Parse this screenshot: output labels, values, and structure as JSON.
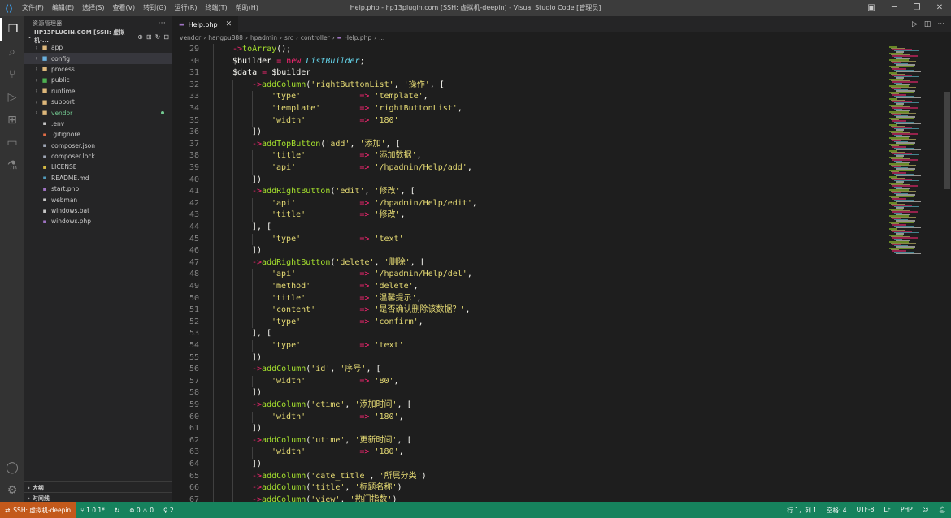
{
  "menubar": {
    "items": [
      "文件(F)",
      "编辑(E)",
      "选择(S)",
      "查看(V)",
      "转到(G)",
      "运行(R)",
      "终端(T)",
      "帮助(H)"
    ],
    "window_title": "Help.php - hp13plugin.com [SSH: 虚拟机-deepin] - Visual Studio Code [管理员]"
  },
  "sidebar": {
    "header": "资源管理器",
    "section_title": "HP13PLUGIN.COM [SSH: 虚拟机-...",
    "items": [
      {
        "label": "app",
        "type": "folder"
      },
      {
        "label": "config",
        "type": "folder"
      },
      {
        "label": "process",
        "type": "folder"
      },
      {
        "label": "public",
        "type": "folder"
      },
      {
        "label": "runtime",
        "type": "folder"
      },
      {
        "label": "support",
        "type": "folder"
      },
      {
        "label": "vendor",
        "type": "folder"
      },
      {
        "label": ".env",
        "type": "file"
      },
      {
        "label": ".gitignore",
        "type": "file"
      },
      {
        "label": "composer.json",
        "type": "file"
      },
      {
        "label": "composer.lock",
        "type": "file"
      },
      {
        "label": "LICENSE",
        "type": "file"
      },
      {
        "label": "README.md",
        "type": "file"
      },
      {
        "label": "start.php",
        "type": "file"
      },
      {
        "label": "webman",
        "type": "file"
      },
      {
        "label": "windows.bat",
        "type": "file"
      },
      {
        "label": "windows.php",
        "type": "file"
      }
    ],
    "outline": "大纲",
    "timeline": "时间线"
  },
  "tab": {
    "label": "Help.php"
  },
  "breadcrumb": [
    "vendor",
    "hangpu888",
    "hpadmin",
    "src",
    "controller",
    "Help.php",
    "..."
  ],
  "code": {
    "lines": [
      {
        "n": "29",
        "i": 2,
        "t": [
          [
            "->",
            "t-arrow"
          ],
          [
            "toArray",
            "t-fn"
          ],
          [
            "();",
            "t-p"
          ]
        ]
      },
      {
        "n": "30",
        "i": 2,
        "t": [
          [
            "$builder",
            "t-var"
          ],
          [
            " = ",
            "t-op"
          ],
          [
            "new ",
            "t-kw"
          ],
          [
            "ListBuilder",
            "t-cls"
          ],
          [
            ";",
            "t-p"
          ]
        ]
      },
      {
        "n": "31",
        "i": 2,
        "t": [
          [
            "$data",
            "t-var"
          ],
          [
            " = ",
            "t-op"
          ],
          [
            "$builder",
            "t-var"
          ]
        ]
      },
      {
        "n": "32",
        "i": 3,
        "t": [
          [
            "->",
            "t-arrow"
          ],
          [
            "addColumn",
            "t-fn"
          ],
          [
            "(",
            "t-p"
          ],
          [
            "'rightButtonList'",
            "t-str"
          ],
          [
            ", ",
            "t-p"
          ],
          [
            "'操作'",
            "t-str"
          ],
          [
            ", [",
            "t-p"
          ]
        ]
      },
      {
        "n": "33",
        "i": 4,
        "t": [
          [
            "'type'",
            "t-str"
          ],
          [
            "            => ",
            "t-op"
          ],
          [
            "'template'",
            "t-str"
          ],
          [
            ",",
            "t-p"
          ]
        ]
      },
      {
        "n": "34",
        "i": 4,
        "t": [
          [
            "'template'",
            "t-str"
          ],
          [
            "        => ",
            "t-op"
          ],
          [
            "'rightButtonList'",
            "t-str"
          ],
          [
            ",",
            "t-p"
          ]
        ]
      },
      {
        "n": "35",
        "i": 4,
        "t": [
          [
            "'width'",
            "t-str"
          ],
          [
            "           => ",
            "t-op"
          ],
          [
            "'180'",
            "t-str"
          ]
        ]
      },
      {
        "n": "36",
        "i": 3,
        "t": [
          [
            "])",
            "t-p"
          ]
        ]
      },
      {
        "n": "37",
        "i": 3,
        "t": [
          [
            "->",
            "t-arrow"
          ],
          [
            "addTopButton",
            "t-fn"
          ],
          [
            "(",
            "t-p"
          ],
          [
            "'add'",
            "t-str"
          ],
          [
            ", ",
            "t-p"
          ],
          [
            "'添加'",
            "t-str"
          ],
          [
            ", [",
            "t-p"
          ]
        ]
      },
      {
        "n": "38",
        "i": 4,
        "t": [
          [
            "'title'",
            "t-str"
          ],
          [
            "           => ",
            "t-op"
          ],
          [
            "'添加数据'",
            "t-str"
          ],
          [
            ",",
            "t-p"
          ]
        ]
      },
      {
        "n": "39",
        "i": 4,
        "t": [
          [
            "'api'",
            "t-str"
          ],
          [
            "             => ",
            "t-op"
          ],
          [
            "'/hpadmin/Help/add'",
            "t-str"
          ],
          [
            ",",
            "t-p"
          ]
        ]
      },
      {
        "n": "40",
        "i": 3,
        "t": [
          [
            "])",
            "t-p"
          ]
        ]
      },
      {
        "n": "41",
        "i": 3,
        "t": [
          [
            "->",
            "t-arrow"
          ],
          [
            "addRightButton",
            "t-fn"
          ],
          [
            "(",
            "t-p"
          ],
          [
            "'edit'",
            "t-str"
          ],
          [
            ", ",
            "t-p"
          ],
          [
            "'修改'",
            "t-str"
          ],
          [
            ", [",
            "t-p"
          ]
        ]
      },
      {
        "n": "42",
        "i": 4,
        "t": [
          [
            "'api'",
            "t-str"
          ],
          [
            "             => ",
            "t-op"
          ],
          [
            "'/hpadmin/Help/edit'",
            "t-str"
          ],
          [
            ",",
            "t-p"
          ]
        ]
      },
      {
        "n": "43",
        "i": 4,
        "t": [
          [
            "'title'",
            "t-str"
          ],
          [
            "           => ",
            "t-op"
          ],
          [
            "'修改'",
            "t-str"
          ],
          [
            ",",
            "t-p"
          ]
        ]
      },
      {
        "n": "44",
        "i": 3,
        "t": [
          [
            "], [",
            "t-p"
          ]
        ]
      },
      {
        "n": "45",
        "i": 4,
        "t": [
          [
            "'type'",
            "t-str"
          ],
          [
            "            => ",
            "t-op"
          ],
          [
            "'text'",
            "t-str"
          ]
        ]
      },
      {
        "n": "46",
        "i": 3,
        "t": [
          [
            "])",
            "t-p"
          ]
        ]
      },
      {
        "n": "47",
        "i": 3,
        "t": [
          [
            "->",
            "t-arrow"
          ],
          [
            "addRightButton",
            "t-fn"
          ],
          [
            "(",
            "t-p"
          ],
          [
            "'delete'",
            "t-str"
          ],
          [
            ", ",
            "t-p"
          ],
          [
            "'删除'",
            "t-str"
          ],
          [
            ", [",
            "t-p"
          ]
        ]
      },
      {
        "n": "48",
        "i": 4,
        "t": [
          [
            "'api'",
            "t-str"
          ],
          [
            "             => ",
            "t-op"
          ],
          [
            "'/hpadmin/Help/del'",
            "t-str"
          ],
          [
            ",",
            "t-p"
          ]
        ]
      },
      {
        "n": "49",
        "i": 4,
        "t": [
          [
            "'method'",
            "t-str"
          ],
          [
            "          => ",
            "t-op"
          ],
          [
            "'delete'",
            "t-str"
          ],
          [
            ",",
            "t-p"
          ]
        ]
      },
      {
        "n": "50",
        "i": 4,
        "t": [
          [
            "'title'",
            "t-str"
          ],
          [
            "           => ",
            "t-op"
          ],
          [
            "'温馨提示'",
            "t-str"
          ],
          [
            ",",
            "t-p"
          ]
        ]
      },
      {
        "n": "51",
        "i": 4,
        "t": [
          [
            "'content'",
            "t-str"
          ],
          [
            "         => ",
            "t-op"
          ],
          [
            "'是否确认删除该数据？'",
            "t-str"
          ],
          [
            ",",
            "t-p"
          ]
        ]
      },
      {
        "n": "52",
        "i": 4,
        "t": [
          [
            "'type'",
            "t-str"
          ],
          [
            "            => ",
            "t-op"
          ],
          [
            "'confirm'",
            "t-str"
          ],
          [
            ",",
            "t-p"
          ]
        ]
      },
      {
        "n": "53",
        "i": 3,
        "t": [
          [
            "], [",
            "t-p"
          ]
        ]
      },
      {
        "n": "54",
        "i": 4,
        "t": [
          [
            "'type'",
            "t-str"
          ],
          [
            "            => ",
            "t-op"
          ],
          [
            "'text'",
            "t-str"
          ]
        ]
      },
      {
        "n": "55",
        "i": 3,
        "t": [
          [
            "])",
            "t-p"
          ]
        ]
      },
      {
        "n": "56",
        "i": 3,
        "t": [
          [
            "->",
            "t-arrow"
          ],
          [
            "addColumn",
            "t-fn"
          ],
          [
            "(",
            "t-p"
          ],
          [
            "'id'",
            "t-str"
          ],
          [
            ", ",
            "t-p"
          ],
          [
            "'序号'",
            "t-str"
          ],
          [
            ", [",
            "t-p"
          ]
        ]
      },
      {
        "n": "57",
        "i": 4,
        "t": [
          [
            "'width'",
            "t-str"
          ],
          [
            "           => ",
            "t-op"
          ],
          [
            "'80'",
            "t-str"
          ],
          [
            ",",
            "t-p"
          ]
        ]
      },
      {
        "n": "58",
        "i": 3,
        "t": [
          [
            "])",
            "t-p"
          ]
        ]
      },
      {
        "n": "59",
        "i": 3,
        "t": [
          [
            "->",
            "t-arrow"
          ],
          [
            "addColumn",
            "t-fn"
          ],
          [
            "(",
            "t-p"
          ],
          [
            "'ctime'",
            "t-str"
          ],
          [
            ", ",
            "t-p"
          ],
          [
            "'添加时间'",
            "t-str"
          ],
          [
            ", [",
            "t-p"
          ]
        ]
      },
      {
        "n": "60",
        "i": 4,
        "t": [
          [
            "'width'",
            "t-str"
          ],
          [
            "           => ",
            "t-op"
          ],
          [
            "'180'",
            "t-str"
          ],
          [
            ",",
            "t-p"
          ]
        ]
      },
      {
        "n": "61",
        "i": 3,
        "t": [
          [
            "])",
            "t-p"
          ]
        ]
      },
      {
        "n": "62",
        "i": 3,
        "t": [
          [
            "->",
            "t-arrow"
          ],
          [
            "addColumn",
            "t-fn"
          ],
          [
            "(",
            "t-p"
          ],
          [
            "'utime'",
            "t-str"
          ],
          [
            ", ",
            "t-p"
          ],
          [
            "'更新时间'",
            "t-str"
          ],
          [
            ", [",
            "t-p"
          ]
        ]
      },
      {
        "n": "63",
        "i": 4,
        "t": [
          [
            "'width'",
            "t-str"
          ],
          [
            "           => ",
            "t-op"
          ],
          [
            "'180'",
            "t-str"
          ],
          [
            ",",
            "t-p"
          ]
        ]
      },
      {
        "n": "64",
        "i": 3,
        "t": [
          [
            "])",
            "t-p"
          ]
        ]
      },
      {
        "n": "65",
        "i": 3,
        "t": [
          [
            "->",
            "t-arrow"
          ],
          [
            "addColumn",
            "t-fn"
          ],
          [
            "(",
            "t-p"
          ],
          [
            "'cate_title'",
            "t-str"
          ],
          [
            ", ",
            "t-p"
          ],
          [
            "'所属分类'",
            "t-str"
          ],
          [
            ")",
            "t-p"
          ]
        ]
      },
      {
        "n": "66",
        "i": 3,
        "t": [
          [
            "->",
            "t-arrow"
          ],
          [
            "addColumn",
            "t-fn"
          ],
          [
            "(",
            "t-p"
          ],
          [
            "'title'",
            "t-str"
          ],
          [
            ", ",
            "t-p"
          ],
          [
            "'标题名称'",
            "t-str"
          ],
          [
            ")",
            "t-p"
          ]
        ]
      },
      {
        "n": "67",
        "i": 3,
        "t": [
          [
            "->",
            "t-arrow"
          ],
          [
            "addColumn",
            "t-fn"
          ],
          [
            "(",
            "t-p"
          ],
          [
            "'view'",
            "t-str"
          ],
          [
            ", ",
            "t-p"
          ],
          [
            "'热门指数'",
            "t-str"
          ],
          [
            ")",
            "t-p"
          ]
        ]
      }
    ]
  },
  "statusbar": {
    "remote": "SSH: 虚拟机-deepin",
    "branch": "1.0.1*",
    "errors": "0",
    "warnings": "0",
    "ports": "2",
    "position": "行 1，列 1",
    "spaces": "空格: 4",
    "encoding": "UTF-8",
    "eol": "LF",
    "language": "PHP"
  },
  "colors": {
    "statusbar": "#16825d",
    "remote": "#c3591b",
    "accent": "#3ea1f0"
  }
}
